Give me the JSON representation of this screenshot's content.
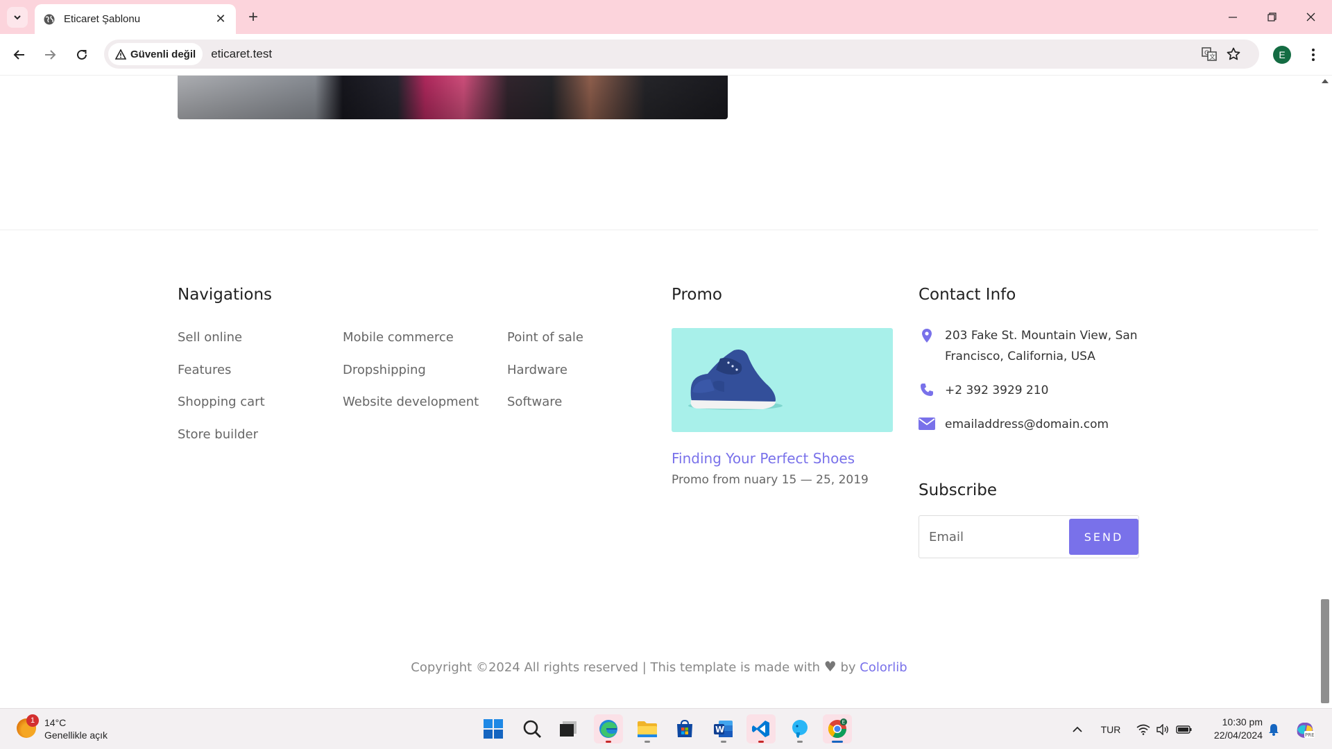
{
  "browser": {
    "tab_title": "Eticaret Şablonu",
    "security_label": "Güvenli değil",
    "url": "eticaret.test",
    "profile_initial": "E"
  },
  "footer": {
    "navigations": {
      "heading": "Navigations",
      "col1": [
        "Sell online",
        "Features",
        "Shopping cart",
        "Store builder"
      ],
      "col2": [
        "Mobile commerce",
        "Dropshipping",
        "Website development"
      ],
      "col3": [
        "Point of sale",
        "Hardware",
        "Software"
      ]
    },
    "promo": {
      "heading": "Promo",
      "title": "Finding Your Perfect Shoes",
      "date": "Promo from nuary 15 — 25, 2019"
    },
    "contact": {
      "heading": "Contact Info",
      "address_line1": "203 Fake St. Mountain View, San",
      "address_line2": "Francisco, California, USA",
      "phone": "+2 392 3929 210",
      "email": "emailaddress@domain.com"
    },
    "subscribe": {
      "heading": "Subscribe",
      "placeholder": "Email",
      "button": "SEND"
    },
    "copyright": {
      "text": "Copyright ©2024 All rights reserved | This template is made with",
      "by": "by",
      "brand": "Colorlib"
    }
  },
  "taskbar": {
    "weather_temp": "14°C",
    "weather_desc": "Genellikle açık",
    "weather_badge": "1",
    "language": "TUR",
    "time": "10:30 pm",
    "date": "22/04/2024"
  },
  "colors": {
    "accent": "#7971ea",
    "tab_strip": "#fcd4dc",
    "promo_bg": "#a8f0ea"
  }
}
